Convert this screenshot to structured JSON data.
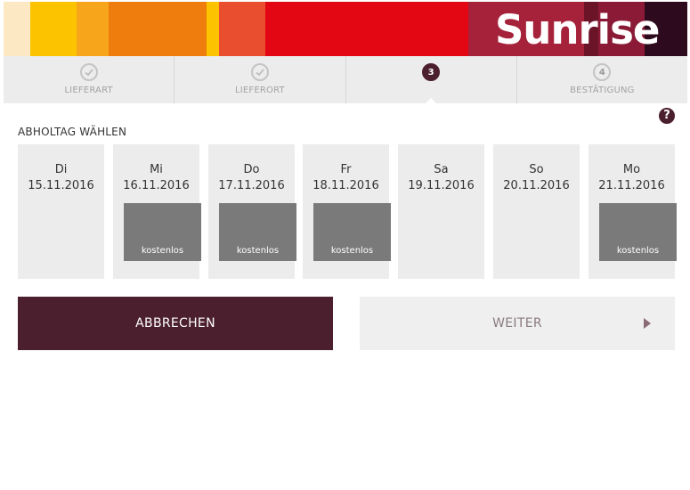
{
  "brand": {
    "logo_text": "Sunrise",
    "colors": {
      "primary": "#4b1f2e",
      "stripe_1": "#fde8c4",
      "stripe_2": "#fcc300",
      "stripe_3": "#f7a51b",
      "stripe_4": "#ee7d0d",
      "stripe_5": "#fcc300",
      "stripe_6": "#e94e2f",
      "stripe_7": "#e30613",
      "stripe_8": "#a5223a",
      "stripe_9": "#6b1428",
      "stripe_10": "#2d0a1d"
    }
  },
  "steps": [
    {
      "number": "1",
      "label": "LIEFERART",
      "state": "completed",
      "icon": "check-icon"
    },
    {
      "number": "2",
      "label": "LIEFERORT",
      "state": "completed",
      "icon": "check-icon"
    },
    {
      "number": "3",
      "label": "",
      "state": "active"
    },
    {
      "number": "4",
      "label": "BESTÄTIGUNG",
      "state": "pending"
    }
  ],
  "help": {
    "label": "?"
  },
  "section": {
    "title": "ABHOLTAG WÄHLEN"
  },
  "days": [
    {
      "weekday": "Di",
      "date": "15.11.2016",
      "slot": ""
    },
    {
      "weekday": "Mi",
      "date": "16.11.2016",
      "slot": "kostenlos"
    },
    {
      "weekday": "Do",
      "date": "17.11.2016",
      "slot": "kostenlos"
    },
    {
      "weekday": "Fr",
      "date": "18.11.2016",
      "slot": "kostenlos"
    },
    {
      "weekday": "Sa",
      "date": "19.11.2016",
      "slot": ""
    },
    {
      "weekday": "So",
      "date": "20.11.2016",
      "slot": ""
    },
    {
      "weekday": "Mo",
      "date": "21.11.2016",
      "slot": "kostenlos"
    }
  ],
  "actions": {
    "cancel_label": "ABBRECHEN",
    "next_label": "WEITER",
    "next_icon": "chevron-right-icon"
  }
}
